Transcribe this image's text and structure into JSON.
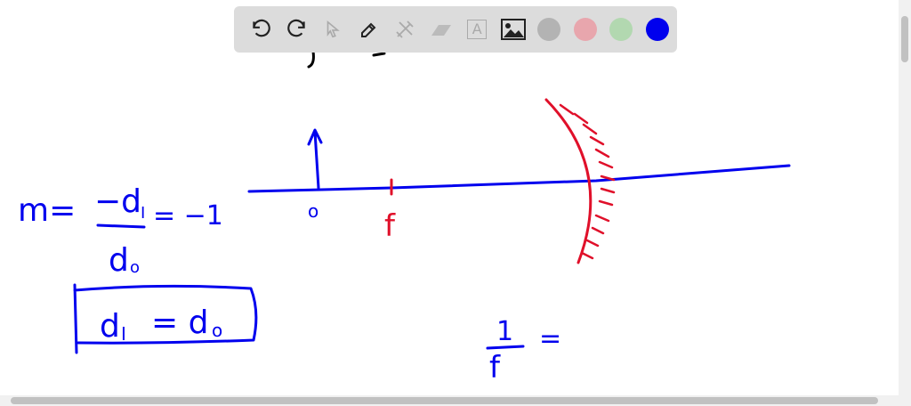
{
  "toolbar": {
    "tools": [
      "undo-icon",
      "redo-icon",
      "select-icon",
      "pen-icon",
      "tools-icon",
      "eraser-icon",
      "text-icon",
      "image-icon"
    ],
    "colors": [
      "#b3b3b3",
      "#e8a6ad",
      "#b2d8b0",
      "#0000ee"
    ],
    "text_tool_label": "A"
  },
  "drawing": {
    "magnification_lhs": "m=",
    "numerator": "−d",
    "numerator_sub": "I",
    "denominator": "d",
    "denominator_sub": "o",
    "result": "= −1",
    "boxed": "d",
    "boxed_sub": "I",
    "boxed_rhs": "= d",
    "boxed_rhs_sub": "o",
    "object_label": "o",
    "focal_label": "f",
    "lens_eq_num": "1",
    "lens_eq_den": "f",
    "lens_eq_eq": "="
  }
}
